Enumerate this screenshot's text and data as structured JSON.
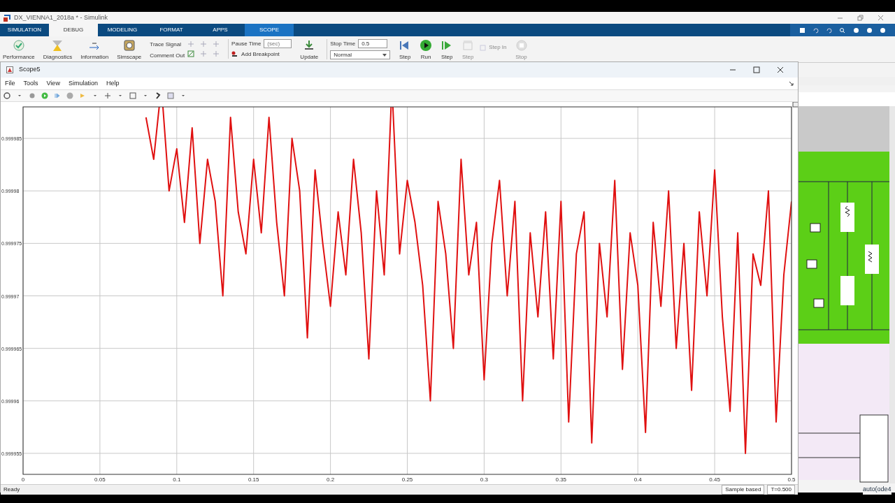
{
  "window": {
    "title": "DX_VIENNA1_2018a * - Simulink"
  },
  "tabs": [
    {
      "label": "SIMULATION",
      "selected": false,
      "kind": "normal"
    },
    {
      "label": "DEBUG",
      "selected": true,
      "kind": "normal"
    },
    {
      "label": "MODELING",
      "selected": false,
      "kind": "normal"
    },
    {
      "label": "FORMAT",
      "selected": false,
      "kind": "normal"
    },
    {
      "label": "APPS",
      "selected": false,
      "kind": "normal"
    },
    {
      "label": "SCOPE",
      "selected": false,
      "kind": "contextual"
    }
  ],
  "ribbon": {
    "performance": "Performance",
    "diagnostics": "Diagnostics",
    "information": "Information",
    "simscape": "Simscape",
    "trace_signal": "Trace Signal",
    "comment_out": "Comment Out",
    "pause_time": {
      "label": "Pause Time",
      "placeholder": "(sec)"
    },
    "add_breakpoint": "Add Breakpoint",
    "update": "Update",
    "stop_time": {
      "label": "Stop Time",
      "value": "0.5"
    },
    "mode": "Normal",
    "steps": [
      {
        "label": "Step",
        "kind": "step-back",
        "disabled": false
      },
      {
        "label": "Run",
        "kind": "run",
        "disabled": false
      },
      {
        "label": "Step",
        "kind": "step-forward",
        "disabled": false
      },
      {
        "label": "Step",
        "kind": "step-over",
        "disabled": true
      }
    ],
    "step_in": {
      "label": "Step In",
      "disabled": true
    },
    "stop": {
      "label": "Stop",
      "disabled": true
    }
  },
  "scope": {
    "title": "Scope5",
    "menu": [
      "File",
      "Tools",
      "View",
      "Simulation",
      "Help"
    ],
    "chart_data": {
      "type": "line",
      "xlim": [
        0,
        0.5
      ],
      "ylim": [
        0.999953,
        0.999988
      ],
      "xticks": [
        0,
        0.05,
        0.1,
        0.15,
        0.2,
        0.25,
        0.3,
        0.35,
        0.4,
        0.45,
        0.5
      ],
      "yticks": [
        0.999955,
        0.99996,
        0.999965,
        0.99997,
        0.999975,
        0.99998,
        0.999985
      ],
      "x": [
        0.08,
        0.085,
        0.09,
        0.095,
        0.1,
        0.105,
        0.11,
        0.115,
        0.12,
        0.125,
        0.13,
        0.135,
        0.14,
        0.145,
        0.15,
        0.155,
        0.16,
        0.165,
        0.17,
        0.175,
        0.18,
        0.185,
        0.19,
        0.195,
        0.2,
        0.205,
        0.21,
        0.215,
        0.22,
        0.225,
        0.23,
        0.235,
        0.24,
        0.245,
        0.25,
        0.255,
        0.26,
        0.265,
        0.27,
        0.275,
        0.28,
        0.285,
        0.29,
        0.295,
        0.3,
        0.305,
        0.31,
        0.315,
        0.32,
        0.325,
        0.33,
        0.335,
        0.34,
        0.345,
        0.35,
        0.355,
        0.36,
        0.365,
        0.37,
        0.375,
        0.38,
        0.385,
        0.39,
        0.395,
        0.4,
        0.405,
        0.41,
        0.415,
        0.42,
        0.425,
        0.43,
        0.435,
        0.44,
        0.445,
        0.45,
        0.455,
        0.46,
        0.465,
        0.47,
        0.475,
        0.48,
        0.485,
        0.49,
        0.495,
        0.5
      ],
      "grid": true,
      "series": [
        {
          "color": "#e01010",
          "values": [
            0.999987,
            0.999983,
            null,
            0.99998,
            0.999984,
            0.999977,
            0.999986,
            0.999975,
            0.999983,
            0.999979,
            0.99997,
            0.999987,
            0.999978,
            0.999974,
            0.999983,
            0.999976,
            0.999987,
            0.999977,
            0.99997,
            0.999985,
            0.99998,
            0.999966,
            0.999982,
            0.999975,
            0.999969,
            0.999978,
            0.999972,
            0.999983,
            0.999976,
            0.999964,
            0.99998,
            0.999972,
            null,
            0.999974,
            0.999981,
            0.999977,
            0.999971,
            0.99996,
            0.999979,
            0.999974,
            0.999965,
            0.999983,
            0.999972,
            0.999977,
            0.999962,
            0.999975,
            0.999981,
            0.99997,
            0.999979,
            0.99996,
            0.999976,
            0.999968,
            0.999978,
            0.999964,
            0.999979,
            0.999958,
            0.999974,
            0.999978,
            0.999956,
            0.999975,
            0.999968,
            0.999981,
            0.999963,
            0.999976,
            0.999971,
            0.999957,
            0.999977,
            0.999969,
            0.99998,
            0.999965,
            0.999975,
            0.999961,
            0.999978,
            0.99997,
            0.999982,
            0.999968,
            0.999959,
            0.999976,
            0.999955,
            0.999974,
            0.999971,
            0.99998,
            0.999958,
            0.999972,
            0.999979
          ]
        }
      ]
    },
    "status": [
      "Ready",
      "Sample based",
      "T=0.500"
    ]
  },
  "model_status": "auto(ode4"
}
